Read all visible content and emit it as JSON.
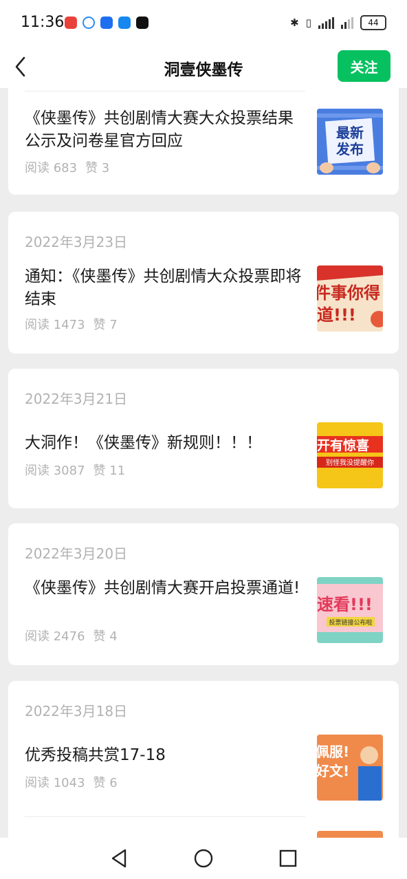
{
  "status": {
    "time": "11:36",
    "battery": "44",
    "apps": [
      {
        "name": "app-red-icon",
        "color": "#e8413c"
      },
      {
        "name": "app-chat-icon",
        "color": "#2b8ef0"
      },
      {
        "name": "app-feather-icon",
        "color": "#1e6ff0"
      },
      {
        "name": "app-blue-icon",
        "color": "#1688f0"
      },
      {
        "name": "app-binance-icon",
        "color": "#111111"
      }
    ]
  },
  "header": {
    "title": "洞壹侠墨传",
    "follow_label": "关注",
    "accent": "#07c160"
  },
  "feed": [
    {
      "date": "",
      "articles": [
        {
          "title": "《侠墨传》共创剧情大赛大众投票结果公示及问卷星官方回应",
          "reads": "阅读 683",
          "likes": "赞 3",
          "thumb": {
            "text": "最新发布",
            "kind": "blue"
          }
        }
      ]
    },
    {
      "date": "2022年3月23日",
      "articles": [
        {
          "title": "通知：《侠墨传》共创剧情大众投票即将结束",
          "reads": "阅读 1473",
          "likes": "赞 7",
          "thumb": {
            "text": "件事你得道!!!",
            "kind": "red"
          }
        }
      ]
    },
    {
      "date": "2022年3月21日",
      "articles": [
        {
          "title": "大洞作！《侠墨传》新规则！！！",
          "reads": "阅读 3087",
          "likes": "赞 11",
          "thumb": {
            "text": "开有惊喜",
            "sub": "别怪我没提醒你",
            "kind": "yellow"
          }
        }
      ]
    },
    {
      "date": "2022年3月20日",
      "articles": [
        {
          "title": "《侠墨传》共创剧情大赛开启投票通道!",
          "reads": "阅读 2476",
          "likes": "赞 4",
          "thumb": {
            "text": "速看!!!",
            "sub": "投票链接公布啦",
            "kind": "pink"
          }
        }
      ]
    },
    {
      "date": "2022年3月18日",
      "articles": [
        {
          "title": "优秀投稿共赏17-18",
          "reads": "阅读 1043",
          "likes": "赞 6",
          "thumb": {
            "text": "佩服!好文!",
            "kind": "orange"
          }
        }
      ]
    }
  ]
}
